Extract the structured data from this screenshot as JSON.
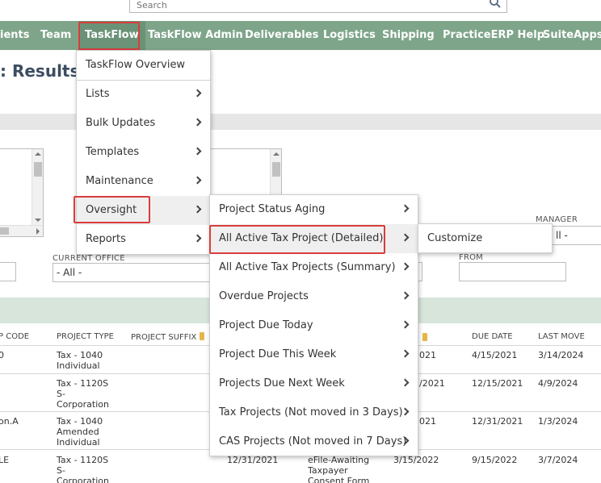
{
  "search": {
    "placeholder": "Search"
  },
  "nav": {
    "items": [
      {
        "label": "ients"
      },
      {
        "label": "Team"
      },
      {
        "label": "TaskFlow"
      },
      {
        "label": "TaskFlow Admin"
      },
      {
        "label": "Deliverables"
      },
      {
        "label": "Logistics"
      },
      {
        "label": "Shipping"
      },
      {
        "label": "PracticeERP Help"
      },
      {
        "label": "SuiteApps"
      }
    ]
  },
  "page": {
    "title": ": Results"
  },
  "filters": {
    "manager_label": "MANAGER",
    "manager_value": "ll -",
    "current_office_label": "CURRENT OFFICE",
    "current_office_value": "- All -",
    "from_label": "FROM",
    "from_value": ""
  },
  "table": {
    "headers": [
      "P CODE",
      "PROJECT TYPE",
      "PROJECT SUFFIX",
      "DUE DATE",
      "LAST MOVE"
    ],
    "rows": [
      {
        "code": "0",
        "type": "Tax - 1040\nIndividual",
        "mid_date": "021",
        "due": "4/15/2021",
        "last": "3/14/2024"
      },
      {
        "code": "",
        "type": "Tax - 1120S\nS-\nCorporation",
        "mid_date": "/2021",
        "due": "12/15/2021",
        "last": "4/9/2024"
      },
      {
        "code": "on.A",
        "type": "Tax - 1040\nAmended\nIndividual",
        "mid_date": "021",
        "due": "12/31/2021",
        "last": "1/3/2024"
      },
      {
        "code": "LE",
        "type": "Tax - 1120S\nS-\nCorporation",
        "date1": "12/31/2021",
        "status": "eFile-Awaiting\nTaxpayer\nConsent Form",
        "mid_date": "3/15/2022",
        "due": "9/15/2022",
        "last": "3/7/2024"
      }
    ]
  },
  "menu_taskflow": {
    "items": [
      {
        "label": "TaskFlow Overview"
      },
      {
        "label": "Lists"
      },
      {
        "label": "Bulk Updates"
      },
      {
        "label": "Templates"
      },
      {
        "label": "Maintenance"
      },
      {
        "label": "Oversight"
      },
      {
        "label": "Reports"
      }
    ]
  },
  "menu_oversight": {
    "items": [
      {
        "label": "Project Status Aging"
      },
      {
        "label": "All Active Tax Project (Detailed)"
      },
      {
        "label": "All Active Tax Projects (Summary)"
      },
      {
        "label": "Overdue Projects"
      },
      {
        "label": "Project Due Today"
      },
      {
        "label": "Project Due This Week"
      },
      {
        "label": "Projects Due Next Week"
      },
      {
        "label": "Tax Projects (Not moved in 3 Days)"
      },
      {
        "label": "CAS Projects (Not moved in 7 Days)"
      }
    ]
  },
  "menu_detailed": {
    "items": [
      {
        "label": "Customize"
      }
    ]
  },
  "colors": {
    "nav_bg": "#7ea58a",
    "highlight_border": "#d93d3d",
    "title": "#3b4d60"
  }
}
